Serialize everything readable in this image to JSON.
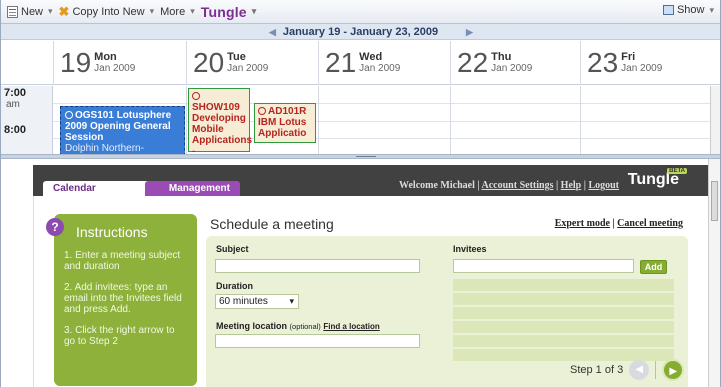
{
  "toolbar": {
    "new_label": "New",
    "copy_label": "Copy Into New",
    "more_label": "More",
    "brand": "Tungle",
    "show_label": "Show"
  },
  "calendar": {
    "range": "January 19 - January 23, 2009",
    "days": [
      {
        "num": "19",
        "weekday": "Mon",
        "date": "Jan 2009"
      },
      {
        "num": "20",
        "weekday": "Tue",
        "date": "Jan 2009"
      },
      {
        "num": "21",
        "weekday": "Wed",
        "date": "Jan 2009"
      },
      {
        "num": "22",
        "weekday": "Thu",
        "date": "Jan 2009"
      },
      {
        "num": "23",
        "weekday": "Fri",
        "date": "Jan 2009"
      }
    ],
    "hours": [
      {
        "label": "7:00",
        "ampm": "am"
      },
      {
        "label": "8:00",
        "ampm": ""
      }
    ],
    "events": [
      {
        "title": "OGS101 Lotusphere 2009 Opening General Session",
        "location": "Dolphin Northern-Southern"
      },
      {
        "title": "SHOW109 Developing Mobile Applications -"
      },
      {
        "title": "AD101R IBM Lotus Applicatio"
      }
    ]
  },
  "tungle": {
    "tabs": {
      "calendar": "Calendar",
      "management": "Management"
    },
    "welcome": "Welcome Michael",
    "account_settings": "Account Settings",
    "help": "Help",
    "logout": "Logout",
    "logo": "Tungle",
    "beta": "BETA",
    "instructions": {
      "title": "Instructions",
      "steps": [
        "1. Enter a meeting subject and duration",
        "2. Add invitees: type an email into the Invitees field and press Add.",
        "3. Click the right arrow to go to Step 2"
      ]
    },
    "schedule_title": "Schedule a meeting",
    "expert_mode": "Expert mode",
    "cancel_meeting": "Cancel meeting",
    "form": {
      "subject_label": "Subject",
      "subject_value": "",
      "invitees_label": "Invitees",
      "invitees_value": "",
      "add_label": "Add",
      "duration_label": "Duration",
      "duration_value": "60 minutes",
      "location_label": "Meeting location",
      "location_optional": "(optional)",
      "find_location": "Find a location",
      "location_value": ""
    },
    "step_label": "Step 1 of 3"
  }
}
